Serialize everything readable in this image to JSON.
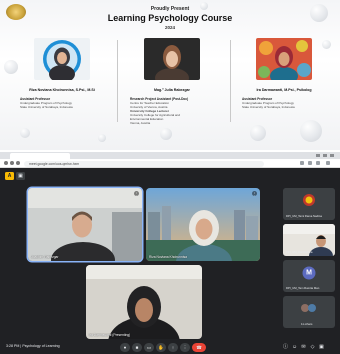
{
  "flyer": {
    "kicker": "Proudly Present",
    "title": "Learning Psychology Course",
    "year": "2024",
    "speakers": [
      {
        "name": "Riza Noviana Khoirunnisa, S.Psi., M.Si",
        "role": "Assistant Professor",
        "lines": [
          "Undergraduate Program of Psychology",
          "State University of Surabaya, Indonesia"
        ]
      },
      {
        "name": "Mag.ª Julia Rabezgar",
        "role": "Research Project Assistant (Post-Doc)",
        "lines": [
          "Centre for Teacher Education",
          "University of Vienna, Austria",
          "",
          "University College Lecturer",
          "University College for Agricultural and",
          "Environmental Education",
          "Vienna, Austria"
        ]
      },
      {
        "name": "Ira Darmawanti, M.Psi., Psikolog",
        "role": "Assistant Professor",
        "lines": [
          "Undergraduate Program of Psychology",
          "State University of Surabaya, Indonesia"
        ]
      }
    ]
  },
  "browser": {
    "url": "meet.google.com/uos-qmhw-hxm"
  },
  "meeting": {
    "tiles": [
      {
        "name": "Joachim Rabezgar"
      },
      {
        "name": "Riza Noviana Khoirunnisa"
      },
      {
        "name": "Ira Darmawanti (Presenting)"
      }
    ],
    "side_tiles": [
      {
        "name": "DPI_UM_Tami Rama Nadina",
        "initial": ""
      },
      {
        "name": "PPI_UM_Dwi Rahma",
        "initial": ""
      },
      {
        "name": "DPI_UM_Tam Ramita Man",
        "initial": "M"
      },
      {
        "name": "11 others",
        "initial": ""
      }
    ],
    "clock": "3:28 PM  |  Psychology of Learning",
    "badge": "A",
    "badge2": "▣"
  },
  "colors": {
    "meet_bg": "#202124",
    "end_call": "#ea4335",
    "active_border": "#8ab4f8",
    "badge": "#fbbc04"
  }
}
